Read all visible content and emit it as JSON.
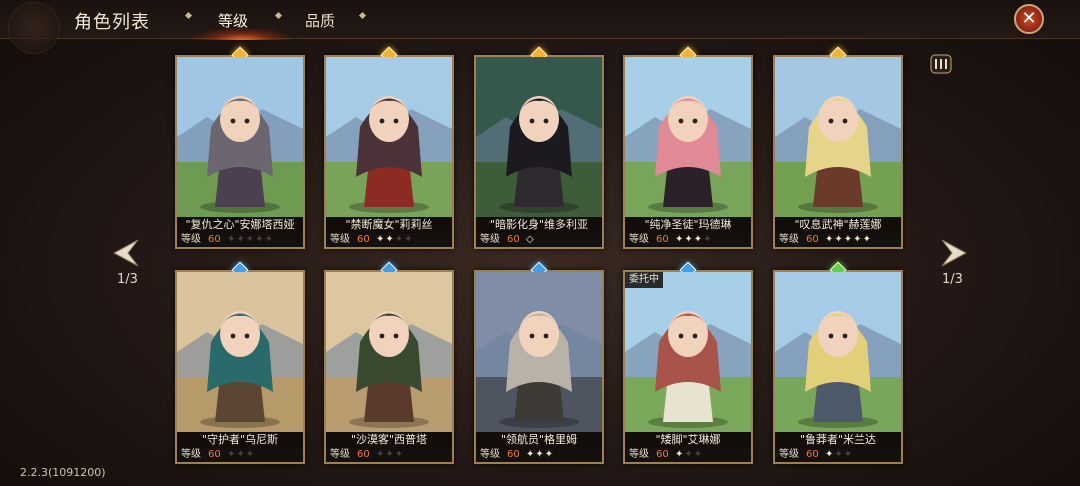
{
  "header": {
    "title": "角色列表",
    "tabs": [
      {
        "label": "等级",
        "active": true
      },
      {
        "label": "品质",
        "active": false
      }
    ],
    "close_icon": "close-x-icon"
  },
  "pagination": {
    "left": "1/3",
    "right": "1/3"
  },
  "version": "2.2.3(1091200)",
  "level_label": "等级",
  "characters": [
    {
      "name": "\"复仇之心\"安娜塔西娅",
      "level": "60",
      "stars": 0,
      "star_slots": 5,
      "gem": "#f2b233",
      "palette": {
        "sky": "#9fc6e4",
        "ground": "#6f9a52",
        "body": "#4a4050",
        "hair": "#6b6670"
      }
    },
    {
      "name": "\"禁断魔女\"莉莉丝",
      "level": "60",
      "stars": 2,
      "star_slots": 4,
      "gem": "#f2b233",
      "palette": {
        "sky": "#a6cbe6",
        "ground": "#7aa35a",
        "body": "#8c2b24",
        "hair": "#4a3238"
      }
    },
    {
      "name": "\"暗影化身\"维多利亚",
      "level": "60",
      "stars": 0,
      "star_slots": 0,
      "gem": "#f2b233",
      "palette": {
        "sky": "#35584d",
        "ground": "#3f5c3a",
        "body": "#2e2a30",
        "hair": "#1d1a1f"
      }
    },
    {
      "name": "\"纯净圣徒\"玛德琳",
      "level": "60",
      "stars": 3,
      "star_slots": 4,
      "gem": "#f2b233",
      "palette": {
        "sky": "#a8cfe8",
        "ground": "#78a55a",
        "body": "#2a2228",
        "hair": "#e08a96"
      }
    },
    {
      "name": "\"叹息武神\"赫莲娜",
      "level": "60",
      "stars": 5,
      "star_slots": 5,
      "gem": "#f2b233",
      "palette": {
        "sky": "#a4c8e4",
        "ground": "#74a052",
        "body": "#6a3a2a",
        "hair": "#e6d48a"
      }
    },
    {
      "name": "\"守护者\"乌尼斯",
      "level": "60",
      "stars": 0,
      "star_slots": 3,
      "gem": "#3f9ef0",
      "palette": {
        "sky": "#d9c49e",
        "ground": "#b79a6a",
        "body": "#5a4632",
        "hair": "#2a6a6a"
      }
    },
    {
      "name": "\"沙漠客\"西普塔",
      "level": "60",
      "stars": 0,
      "star_slots": 3,
      "gem": "#3f9ef0",
      "palette": {
        "sky": "#dcc7a0",
        "ground": "#b99c70",
        "body": "#5a3a2a",
        "hair": "#3a4a30"
      }
    },
    {
      "name": "\"领航员\"格里姆",
      "level": "60",
      "stars": 3,
      "star_slots": 3,
      "gem": "#3f9ef0",
      "palette": {
        "sky": "#7f8ea6",
        "ground": "#4e5560",
        "body": "#3e3a36",
        "hair": "#b8b2a8"
      }
    },
    {
      "name": "\"矮脚\"艾琳娜",
      "level": "60",
      "stars": 1,
      "star_slots": 3,
      "gem": "#3f9ef0",
      "commission": "委托中",
      "palette": {
        "sky": "#a8cfe8",
        "ground": "#7aa85a",
        "body": "#e8e2d0",
        "hair": "#a8544a"
      }
    },
    {
      "name": "\"鲁莽者\"米兰达",
      "level": "60",
      "stars": 1,
      "star_slots": 3,
      "gem": "#5cd04a",
      "palette": {
        "sky": "#a6cbe6",
        "ground": "#78a65a",
        "body": "#4c5a6a",
        "hair": "#e2cf7a"
      }
    }
  ]
}
